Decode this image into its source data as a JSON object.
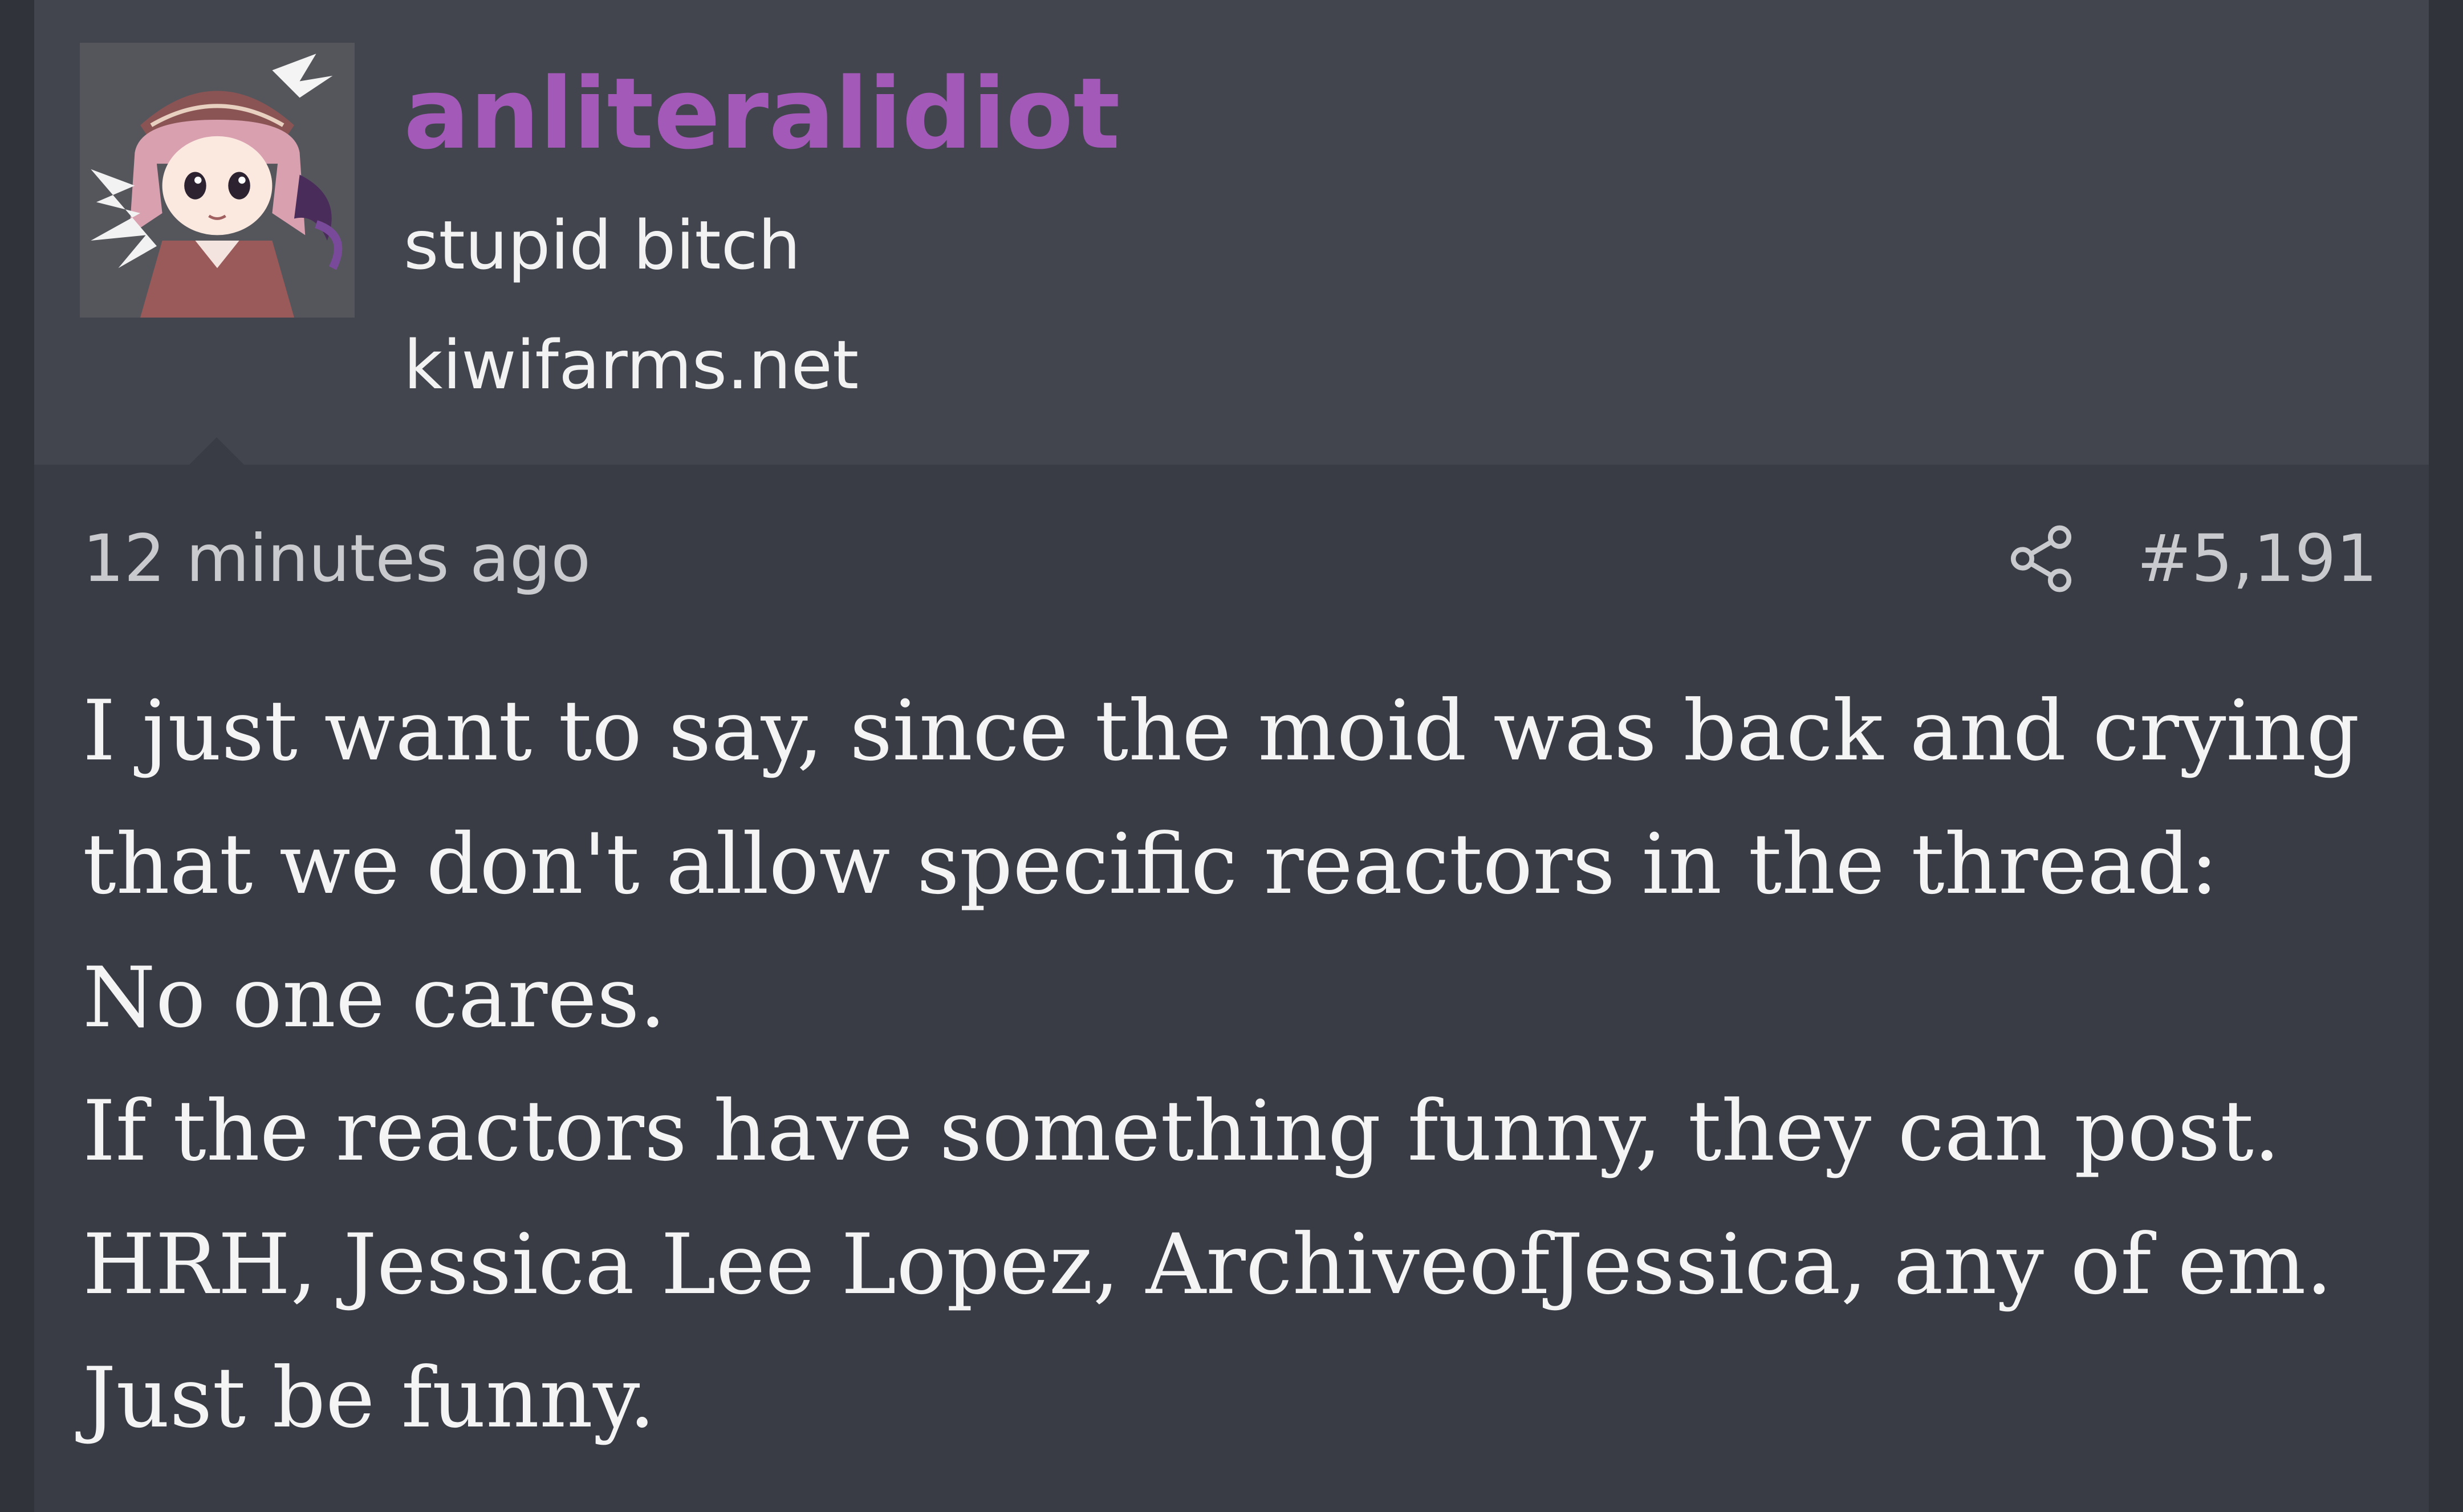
{
  "post": {
    "author": {
      "username": "anliteralidiot",
      "user_title": "stupid bitch",
      "site": "kiwifarms.net",
      "avatar": "anime-character-avatar",
      "username_color": "#a259b8"
    },
    "meta": {
      "timestamp": "12 minutes ago",
      "share_icon": "share-icon",
      "post_number": "#5,191"
    },
    "body": {
      "lines": [
        "I just want to say, since the moid was back and crying",
        "that we don't allow specific reactors in the thread:",
        "No one cares.",
        "If the reactors have something funny, they can post.",
        "HRH, Jessica Lee Lopez, ArchiveofJessica, any of em.",
        "Just be funny."
      ]
    }
  }
}
